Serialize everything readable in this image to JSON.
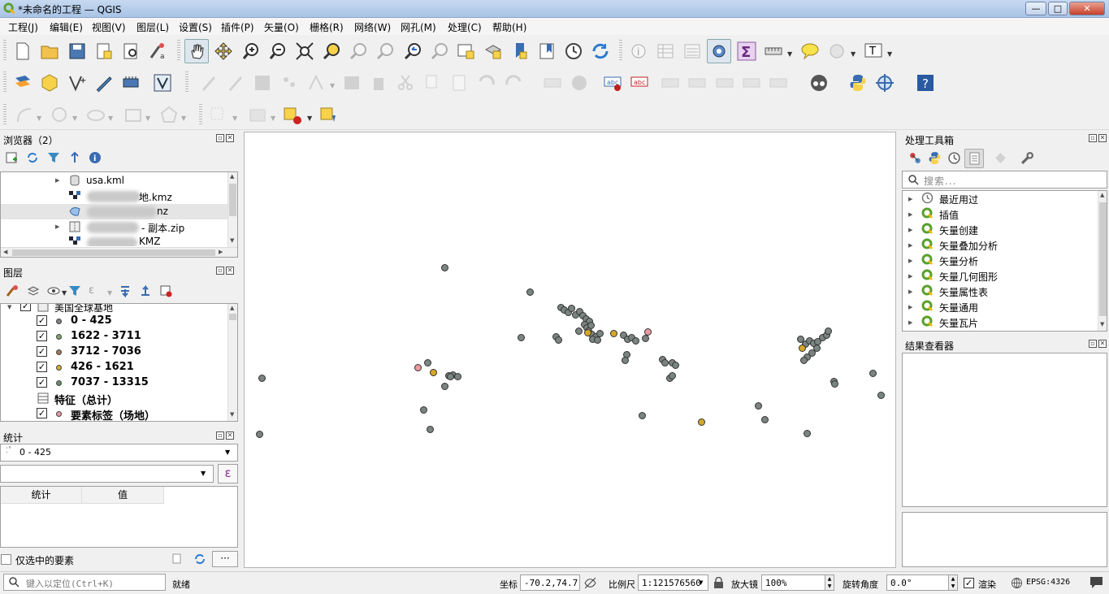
{
  "window": {
    "title": "*未命名的工程 — QGIS",
    "controls": {
      "minimize": "—",
      "maximize": "□",
      "close": "✕"
    }
  },
  "menubar": [
    "工程(J)",
    "编辑(E)",
    "视图(V)",
    "图层(L)",
    "设置(S)",
    "插件(P)",
    "矢量(O)",
    "栅格(R)",
    "网络(W)",
    "网孔(M)",
    "处理(C)",
    "帮助(H)"
  ],
  "browser_panel": {
    "title": "浏览器（2）",
    "items": [
      {
        "label": "usa.kml"
      },
      {
        "label": "地.kmz"
      },
      {
        "label": "nz"
      },
      {
        "label": "- 副本.zip"
      },
      {
        "label": "KMZ"
      }
    ]
  },
  "layers_panel": {
    "title": "图层",
    "group_label": "美国全球基地",
    "legend": [
      {
        "label": "0 - 425",
        "color": "#808080"
      },
      {
        "label": "1622 - 3711",
        "color": "#7fa36b"
      },
      {
        "label": "3712 - 7036",
        "color": "#a0785a"
      },
      {
        "label": "426 - 1621",
        "color": "#d4ad3a"
      },
      {
        "label": "7037 - 13315",
        "color": "#6b8b6b"
      }
    ],
    "feature_total": "特征（总计）",
    "label_layer": "要素标签（场地）"
  },
  "stats_panel": {
    "title": "统计",
    "layer_select": "0 - 425",
    "expr_button": "ε",
    "columns": [
      "统计",
      "值"
    ],
    "selected_only": "仅选中的要素",
    "more_button": "···"
  },
  "toolbox_panel": {
    "title": "处理工具箱",
    "search_placeholder": "搜索...",
    "items": [
      "最近用过",
      "插值",
      "矢量创建",
      "矢量叠加分析",
      "矢量分析",
      "矢量几何图形",
      "矢量属性表",
      "矢量通用",
      "矢量瓦片"
    ]
  },
  "results_panel": {
    "title": "结果查看器"
  },
  "statusbar": {
    "locator_placeholder": "键入以定位(Ctrl+K)",
    "ready": "就绪",
    "coord_label": "坐标",
    "coord_value": "-70.2,74.7",
    "scale_label": "比例尺",
    "scale_value": "1:121576560",
    "magnifier_label": "放大镜",
    "magnifier_value": "100%",
    "rotation_label": "旋转角度",
    "rotation_value": "0.0°",
    "render_label": "渲染",
    "crs": "EPSG:4326"
  },
  "map_points": {
    "colors": {
      "gray": "#7a8480",
      "yellow": "#d4a82a",
      "pink": "#e89aa0"
    }
  }
}
